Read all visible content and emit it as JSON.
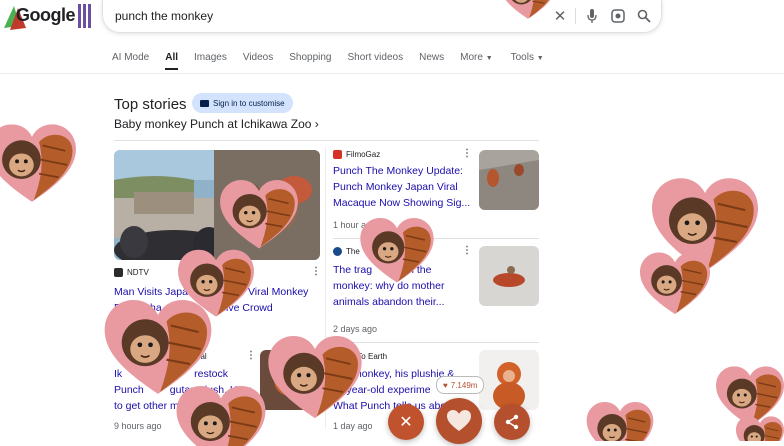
{
  "header": {
    "logo_text": "Google",
    "query": "punch the monkey",
    "icons": [
      "close-icon",
      "mic-icon",
      "lens-icon",
      "search-icon"
    ]
  },
  "tabs": [
    "AI Mode",
    "All",
    "Images",
    "Videos",
    "Shopping",
    "Short videos",
    "News",
    "More",
    "Tools"
  ],
  "active_tab": "All",
  "top_stories": {
    "title": "Top stories",
    "signin_label": "Sign in to customise",
    "subtitle": "Baby monkey Punch at Ichikawa Zoo"
  },
  "cards": {
    "left_main": {
      "source": "NDTV",
      "headline_1": "Man Visits Japa",
      "headline_1b": "Viral Monkey",
      "headline_2a": "P",
      "headline_2b": "Sha",
      "headline_2c": "assive Crowd"
    },
    "right_1": {
      "source": "FilmoGaz",
      "headline": "Punch The Monkey Update: Punch Monkey Japan Viral Macaque Now Showing Sig...",
      "time": "1 hour ag"
    },
    "right_2": {
      "source": "The",
      "headline_a": "The trag",
      "headline_b": "n the",
      "headline_c": "monkey: why do mother animals abandon their...",
      "time": "2 days ago"
    },
    "bottom_left": {
      "source": "nal",
      "headline_a": "Ik",
      "headline_b": "restock",
      "headline_c": "Punch",
      "headline_d": "gutan plush. How",
      "headline_e": "to get other mer",
      "time": "9 hours ago"
    },
    "bottom_right": {
      "source": "wn To Earth",
      "headline_a": "monkey, his plushie &",
      "headline_b": "-year-old experime",
      "headline_c": "What Punch tells us abo",
      "time": "1 day ago"
    }
  },
  "overlay": {
    "likes": "7.149m",
    "colors": {
      "close": "#c0522e",
      "heart": "#b5502e",
      "share": "#b5502e"
    }
  }
}
